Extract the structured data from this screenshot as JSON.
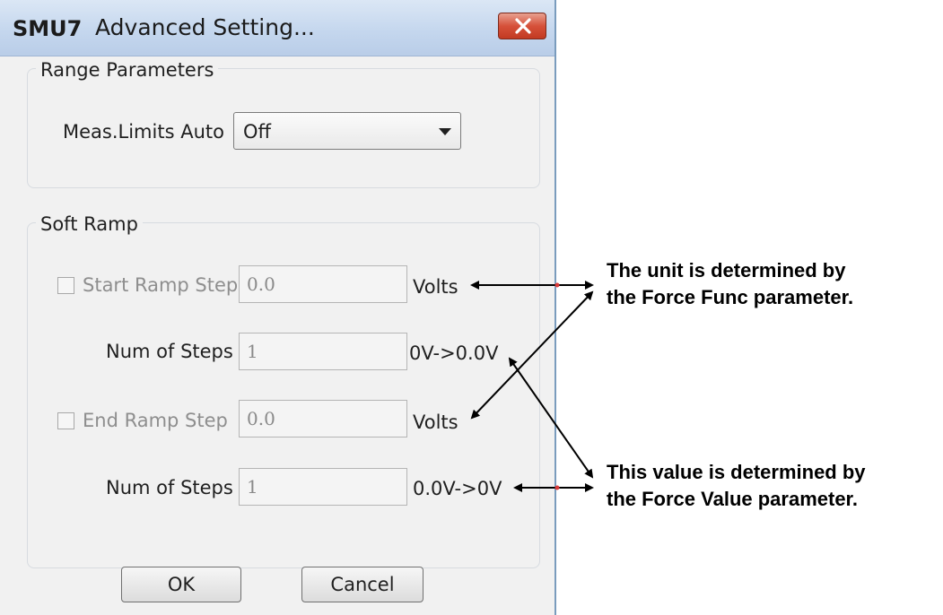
{
  "window": {
    "app_label": "SMU7",
    "title": "Advanced Setting...",
    "close_icon": "close-icon",
    "accent_color": "#c8362a"
  },
  "range_parameters": {
    "group_title": "Range Parameters",
    "meas_limits_label": "Meas.Limits Auto",
    "meas_limits_value": "Off"
  },
  "soft_ramp": {
    "group_title": "Soft Ramp",
    "start_ramp_label": "Start Ramp Step",
    "start_ramp_value": "0.0",
    "start_ramp_unit": "Volts",
    "start_num_steps_label": "Num of Steps",
    "start_num_steps_value": "1",
    "start_range_text": "0V->0.0V",
    "end_ramp_label": "End Ramp Step",
    "end_ramp_value": "0.0",
    "end_ramp_unit": "Volts",
    "end_num_steps_label": "Num of Steps",
    "end_num_steps_value": "1",
    "end_range_text": "0.0V->0V"
  },
  "buttons": {
    "ok_label": "OK",
    "cancel_label": "Cancel"
  },
  "annotations": {
    "unit_note_line1": "The unit is determined by",
    "unit_note_line2": "the Force Func parameter.",
    "value_note_line1": "This value is determined by",
    "value_note_line2": "the Force Value parameter."
  }
}
